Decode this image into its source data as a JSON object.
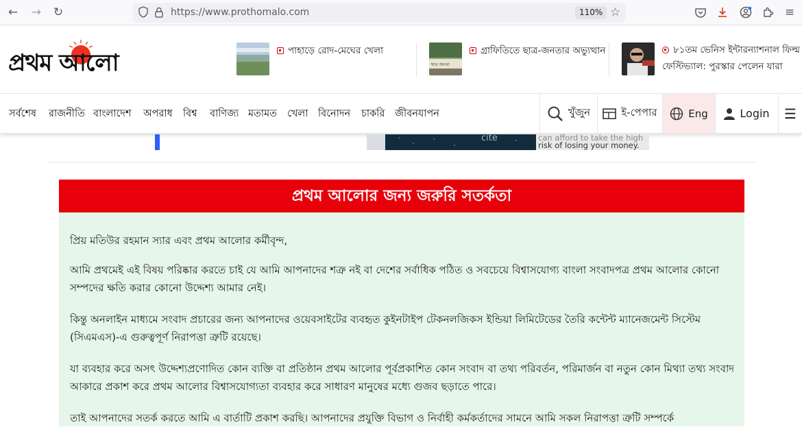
{
  "browser": {
    "url": "https://www.prothomalo.com",
    "zoom": "110%",
    "icons": [
      "back-arrow-icon",
      "forward-arrow-icon",
      "reload-icon",
      "shield-icon",
      "lock-icon",
      "bookmark-star-icon",
      "pocket-icon",
      "download-icon",
      "account-icon",
      "extensions-icon",
      "menu-icon"
    ]
  },
  "site": {
    "logo_text": "প্রথম আলো",
    "colors": {
      "brand_red": "#e8000b",
      "notice_bg": "#e7f6ea"
    }
  },
  "headlines": [
    {
      "text": "পাহাড়ে রোদ-মেঘের খেলা",
      "line2": ""
    },
    {
      "text": "গ্রাফিতিতে ছাত্র-জনতার অভ্যুত্থান",
      "line2": ""
    },
    {
      "text": "৮১তম ভেনিস ইন্টারন্যাশনাল ফিল্ম",
      "line2": "ফেস্টিভ্যাল: পুরস্কার পেলেন যারা"
    }
  ],
  "nav": {
    "items": [
      "সর্বশেষ",
      "রাজনীতি",
      "বাংলাদেশ",
      "অপরাধ",
      "বিশ্ব",
      "বাণিজ্য",
      "মতামত",
      "খেলা",
      "বিনোদন",
      "চাকরি",
      "জীবনযাপন"
    ],
    "search_label": "খুঁজুন",
    "epaper_label": "ই-পেপার",
    "lang_label": "Eng",
    "login_label": "Login"
  },
  "ad": {
    "line1": "can afford to take the high",
    "line2": "risk of losing your money."
  },
  "notice": {
    "title": "প্রথম আলোর জন্য জরুরি সতর্কতা",
    "paragraphs": [
      "প্রিয় মতিউর রহমান স্যার এবং প্রথম আলোর কর্মীবৃন্দ,",
      "আমি প্রথমেই এই বিষয় পরিষ্কার করতে চাই যে আমি আপনাদের শত্রু নই বা দেশের সর্বাধিক পঠিত ও সবচেয়ে বিশ্বাসযোগ্য বাংলা সংবাদপত্র প্রথম আলোর কোনো সম্পদের ক্ষতি করার কোনো উদ্দেশ্য আমার নেই।",
      "কিন্তু অনলাইন মাধ্যমে সংবাদ প্রচারের জন্য আপনাদের ওয়েবসাইটের ব্যবহৃত কুইনটাইপ টেকনলজিকস ইন্ডিয়া লিমিটেডের তৈরি কন্টেন্ট ম্যানেজমেন্ট সিস্টেম (সিএমএস)-এ গুরুত্বপূর্ণ নিরাপত্তা ত্রুটি রয়েছে।",
      "যা ব্যবহার করে অসৎ উদ্দেশ্যপ্রণোদিত কোন ব্যক্তি বা প্রতিষ্ঠান প্রথম আলোর পূর্বপ্রকাশিত কোন সংবাদ বা তথ্য পরিবর্তন, পরিমার্জন বা নতুন কোন মিথ্যা তথ্য সংবাদ আকারে প্রকাশ করে প্রথম আলোর বিশ্বাসযোগ্যতা ব্যবহার করে সাধারণ মানুষের মধ্যে গুজব ছড়াতে পারে।",
      "তাই আপনাদের সতর্ক করতে আমি এ বার্তাটি প্রকাশ করছি। আপনাদের প্রযুক্তি বিভাগ ও নির্বাহী কর্মকর্তাদের সামনে আমি সকল নিরাপত্তা ত্রুটি সম্পর্কে"
    ]
  }
}
